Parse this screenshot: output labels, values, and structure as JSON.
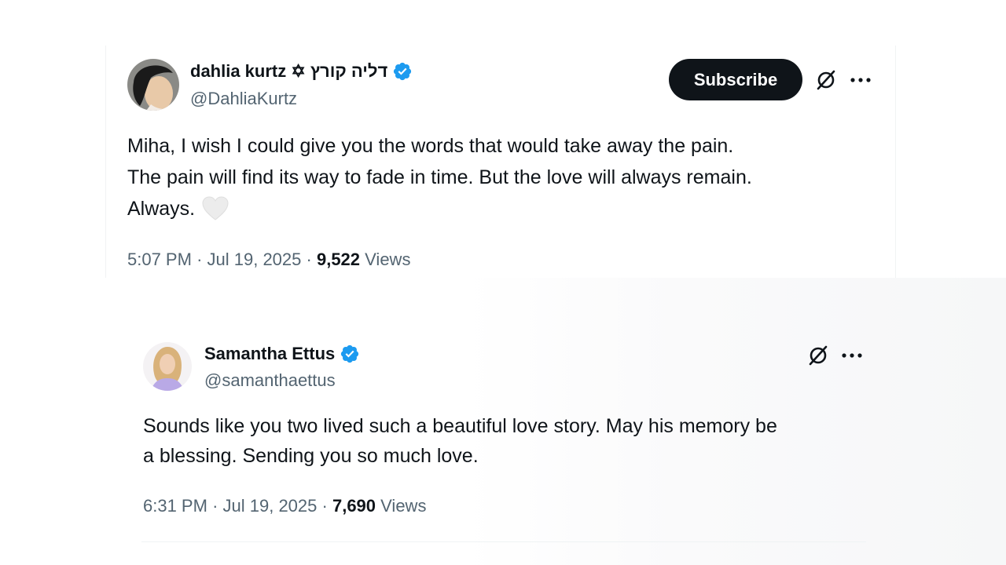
{
  "tweet1": {
    "display_name": "dahlia kurtz ✡ דליה קורץ",
    "handle": "@DahliaKurtz",
    "subscribe_label": "Subscribe",
    "text_lines": [
      "Miha, I wish I could give you the words that would take away the pain.",
      "The pain will find its way to fade in time. But the love will always remain.",
      "Always."
    ],
    "time": "5:07 PM",
    "date": "Jul 19, 2025",
    "separator": "·",
    "views_count": "9,522",
    "views_label": "Views"
  },
  "tweet2": {
    "display_name": "Samantha Ettus",
    "handle": "@samanthaettus",
    "text_lines": [
      "Sounds like you two lived such a beautiful love story. May his memory be",
      "a blessing. Sending you so much love."
    ],
    "time": "6:31 PM",
    "date": "Jul 19, 2025",
    "separator": "·",
    "views_count": "7,690",
    "views_label": "Views"
  },
  "icons": {
    "verified": "verified-badge-icon",
    "grok": "grok-icon",
    "more": "more-options-icon",
    "heart": "white-heart-emoji"
  },
  "colors": {
    "verified_blue": "#1d9bf0",
    "subscribe_bg": "#0f1419",
    "secondary_text": "#536471"
  }
}
